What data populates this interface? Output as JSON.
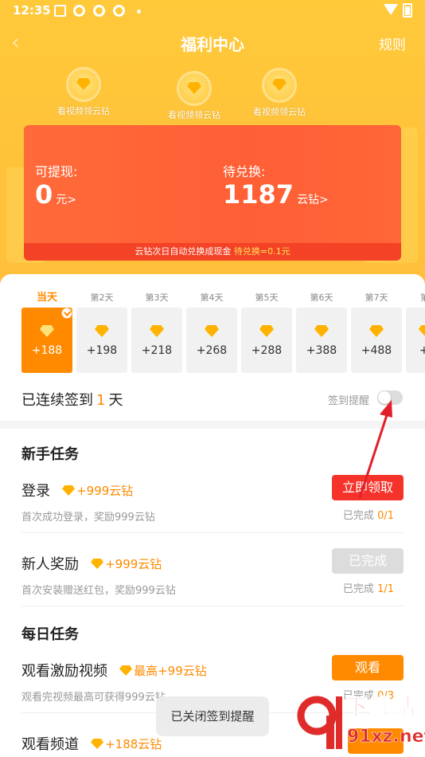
{
  "status_bar": {
    "time": "12:35"
  },
  "nav": {
    "title": "福利中心",
    "rule": "规则"
  },
  "video_coins": [
    {
      "label": "看视频领云钻"
    },
    {
      "label": "看视频领云钻"
    },
    {
      "label": "看视频领云钻"
    }
  ],
  "balance": {
    "withdraw_label": "可提现:",
    "withdraw_value": "0",
    "withdraw_unit": "元>",
    "exchange_label": "待兑换:",
    "exchange_value": "1187",
    "exchange_unit": "云钻>",
    "note": "云钻次日自动兑换成现金",
    "note_highlight": "待兑换=0.1元"
  },
  "checkin": {
    "days": [
      {
        "label": "当天",
        "points": "+188",
        "active": true
      },
      {
        "label": "第2天",
        "points": "+198"
      },
      {
        "label": "第3天",
        "points": "+218"
      },
      {
        "label": "第4天",
        "points": "+268"
      },
      {
        "label": "第5天",
        "points": "+288"
      },
      {
        "label": "第6天",
        "points": "+388"
      },
      {
        "label": "第7天",
        "points": "+488"
      },
      {
        "label": "第",
        "points": "+"
      }
    ],
    "streak_prefix": "已连续签到",
    "streak_count": "1",
    "streak_suffix": "天",
    "remind_label": "签到提醒",
    "remind_on": false
  },
  "newbie": {
    "title": "新手任务",
    "tasks": [
      {
        "name": "登录",
        "reward": "+999云钻",
        "desc": "首次成功登录，奖励999云钻",
        "button": "立即领取",
        "progress_label": "已完成",
        "progress": "0/1"
      },
      {
        "name": "新人奖励",
        "reward": "+999云钻",
        "desc": "首次安装赠送红包，奖励999云钻",
        "button": "已完成",
        "progress_label": "已完成",
        "progress": "1/1"
      }
    ]
  },
  "daily": {
    "title": "每日任务",
    "tasks": [
      {
        "name": "观看激励视频",
        "reward": "最高+99云钻",
        "desc": "观看完视频最高可获得999云钻",
        "button": "观看",
        "progress_label": "已完成",
        "progress": "0/3"
      },
      {
        "name": "观看频道",
        "reward": "+188云钻"
      }
    ]
  },
  "toast": "已关闭签到提醒",
  "watermark": {
    "text1": "下载站",
    "text2": "91xz.net"
  },
  "colors": {
    "header_yellow": "#ffc23a",
    "card_orange": "#ff6a3a",
    "accent": "#ff8a00",
    "claim_red": "#f5332a"
  }
}
